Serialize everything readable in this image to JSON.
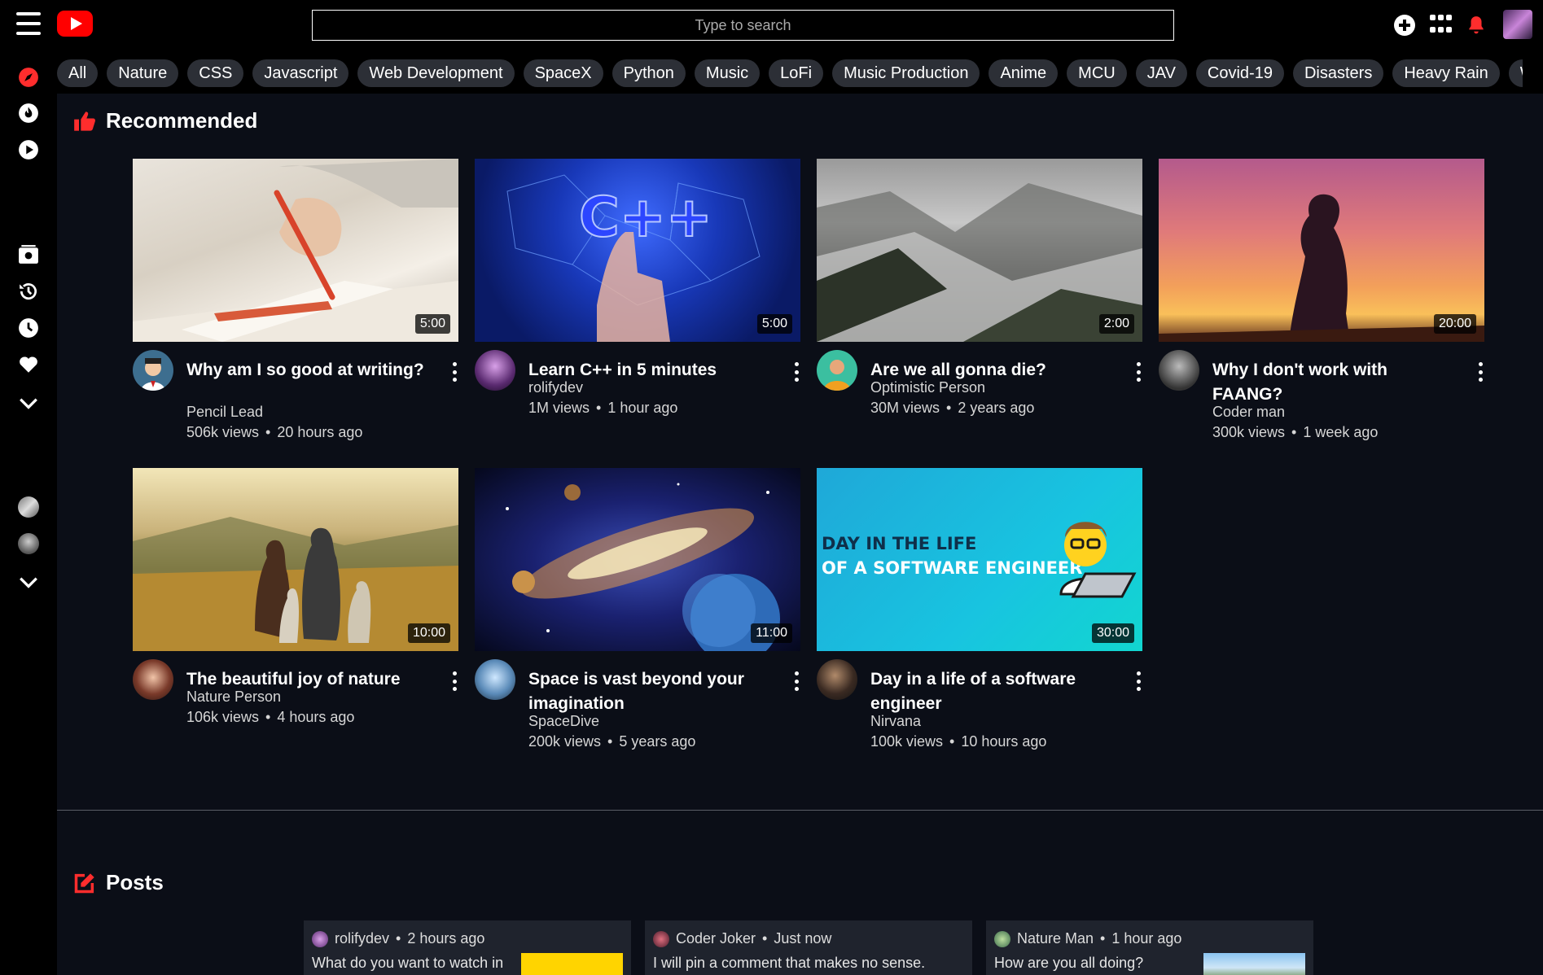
{
  "search": {
    "placeholder": "Type to search"
  },
  "chips": [
    "All",
    "Nature",
    "CSS",
    "Javascript",
    "Web Development",
    "SpaceX",
    "Python",
    "Music",
    "LoFi",
    "Music Production",
    "Anime",
    "MCU",
    "JAV",
    "Covid-19",
    "Disasters",
    "Heavy Rain",
    "Wi"
  ],
  "sections": {
    "recommended": "Recommended",
    "posts": "Posts"
  },
  "videos": [
    {
      "title": "Why am I so good at writing?",
      "channel": "Pencil Lead",
      "views": "506k views",
      "age": "20 hours ago",
      "duration": "5:00"
    },
    {
      "title": "Learn C++ in 5 minutes",
      "channel": "rolifydev",
      "views": "1M views",
      "age": "1 hour ago",
      "duration": "5:00"
    },
    {
      "title": "Are we all gonna die?",
      "channel": "Optimistic Person",
      "views": "30M views",
      "age": "2 years ago",
      "duration": "2:00"
    },
    {
      "title": "Why I don't work with FAANG?",
      "channel": "Coder man",
      "views": "300k views",
      "age": "1 week ago",
      "duration": "20:00"
    },
    {
      "title": "The beautiful joy of nature",
      "channel": "Nature Person",
      "views": "106k views",
      "age": "4 hours ago",
      "duration": "10:00"
    },
    {
      "title": "Space is vast beyond your imagination",
      "channel": "SpaceDive",
      "views": "200k views",
      "age": "5 years ago",
      "duration": "11:00"
    },
    {
      "title": "Day in a life of a software engineer",
      "channel": "Nirvana",
      "views": "100k views",
      "age": "10 hours ago",
      "duration": "30:00"
    }
  ],
  "thumb_text": {
    "cpp": "C++",
    "day_line1": "DAY IN THE LIFE",
    "day_line2": "OF A SOFTWARE ENGINEER"
  },
  "bullet": "•",
  "posts": [
    {
      "author": "rolifydev",
      "time": "2 hours ago",
      "text": "What do you want to watch in"
    },
    {
      "author": "Coder Joker",
      "time": "Just now",
      "text": "I will pin a comment that makes no sense."
    },
    {
      "author": "Nature Man",
      "time": "1 hour ago",
      "text": "How are you all doing?"
    }
  ],
  "icons": {
    "menu": "hamburger-menu-icon",
    "logo": "youtube-logo-icon",
    "create": "plus-circle-icon",
    "apps": "apps-grid-icon",
    "notifications": "bell-icon",
    "sidebar": [
      "compass-icon",
      "flame-icon",
      "play-circle-icon",
      "library-icon",
      "history-icon",
      "clock-icon",
      "heart-icon",
      "chevron-down-icon"
    ]
  },
  "colors": {
    "accent": "#ff0000",
    "background": "#000000",
    "main_bg": "#0b0e17",
    "chip_bg": "#2c2f36",
    "card_bg": "#1f232d"
  }
}
